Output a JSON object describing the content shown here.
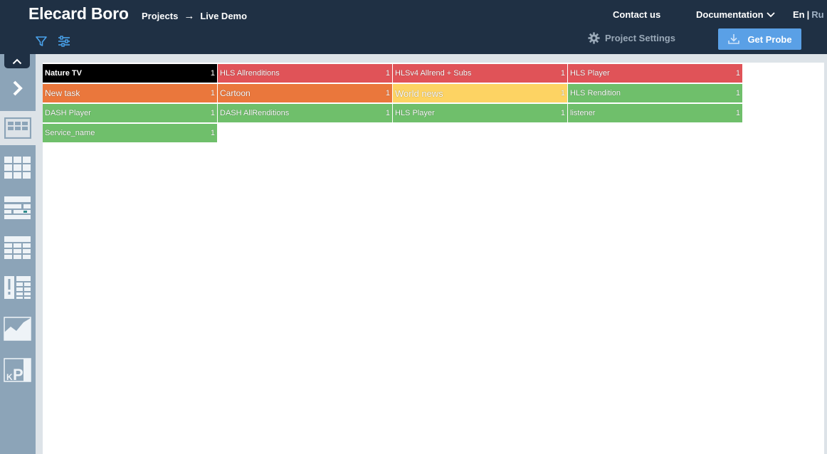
{
  "header": {
    "brand": "Elecard Boro",
    "breadcrumb": [
      "Projects",
      "Live Demo"
    ],
    "breadcrumb_arrow": "→",
    "contact": "Contact us",
    "docs": "Documentation",
    "lang_active": "En",
    "lang_sep": "|",
    "lang_inactive": "Ru",
    "settings": "Project Settings",
    "probe_button": "Get Probe"
  },
  "colors": {
    "black": "#000000",
    "red": "#e05358",
    "orange": "#ea773c",
    "yellow": "#fdd363",
    "green": "#6fbf6b",
    "header_bg": "#1f3044",
    "accent": "#5aa0e6"
  },
  "tasks": [
    {
      "name": "Nature TV",
      "count": "1",
      "status": "black"
    },
    {
      "name": "HLS Allrenditions",
      "count": "1",
      "status": "red"
    },
    {
      "name": "HLSv4 Allrend + Subs",
      "count": "1",
      "status": "red"
    },
    {
      "name": "HLS Player",
      "count": "1",
      "status": "red"
    },
    {
      "name": "New task",
      "count": "1",
      "status": "orange"
    },
    {
      "name": "Cartoon",
      "count": "1",
      "status": "orange"
    },
    {
      "name": "World news",
      "count": "1",
      "status": "yellow"
    },
    {
      "name": "HLS Rendition",
      "count": "1",
      "status": "green"
    },
    {
      "name": "DASH Player",
      "count": "1",
      "status": "green"
    },
    {
      "name": "DASH AllRenditions",
      "count": "1",
      "status": "green"
    },
    {
      "name": "HLS Player",
      "count": "1",
      "status": "green"
    },
    {
      "name": "listener",
      "count": "1",
      "status": "green"
    },
    {
      "name": "Service_name",
      "count": "1",
      "status": "green"
    }
  ],
  "sidebar_icons": [
    "chevron-up-icon",
    "chevron-right-icon",
    "tiles-view-icon",
    "grid-view-icon",
    "rows-view-icon",
    "table-view-icon",
    "alerts-view-icon",
    "chart-view-icon",
    "kpi-view-icon"
  ]
}
